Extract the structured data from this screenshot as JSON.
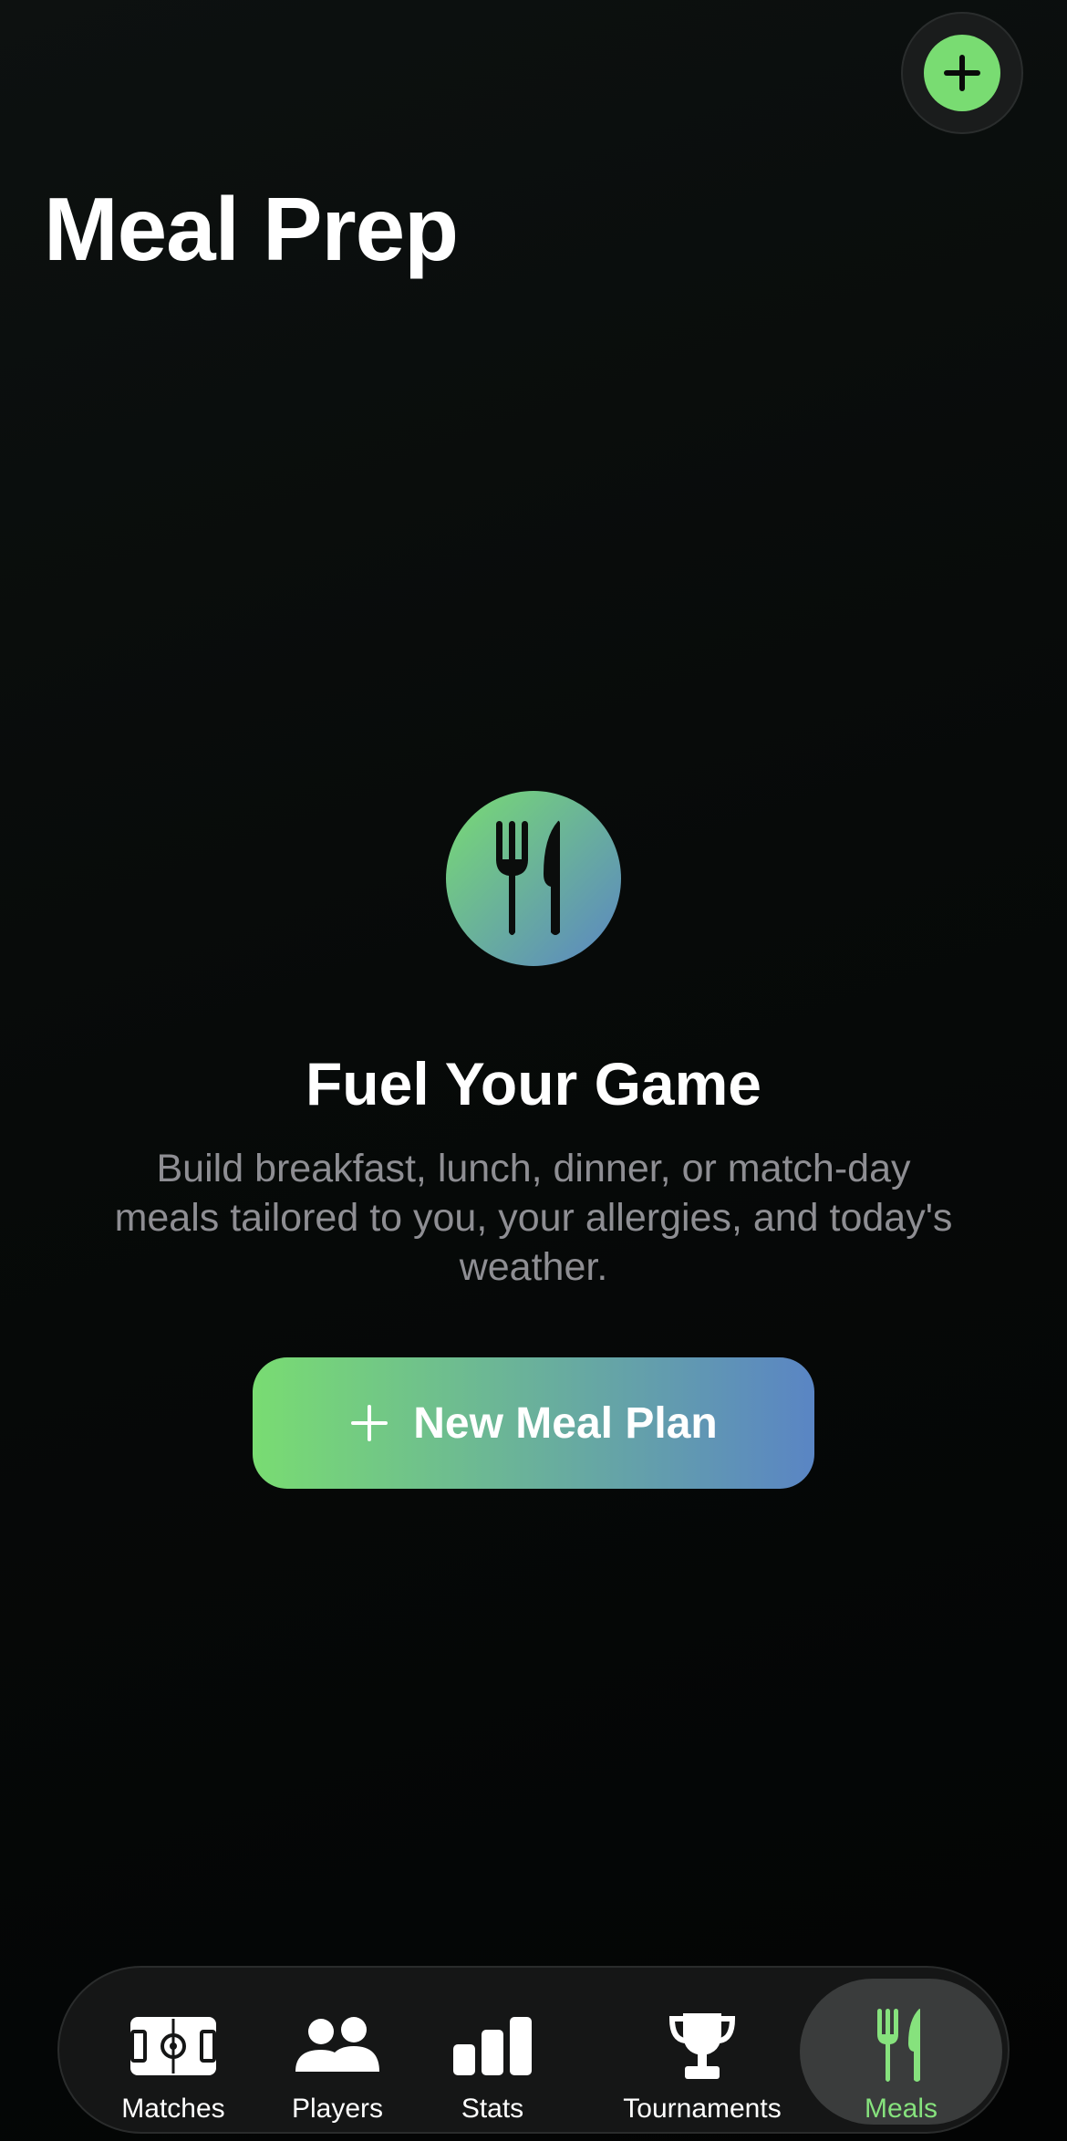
{
  "header": {
    "title": "Meal Prep",
    "add_button_icon": "plus-icon"
  },
  "empty_state": {
    "icon": "fork-knife-icon",
    "title": "Fuel Your Game",
    "description": "Build breakfast, lunch, dinner, or match-day meals tailored to you, your allergies, and today's weather.",
    "cta_label": "New Meal Plan",
    "cta_icon": "plus-icon"
  },
  "tabbar": {
    "items": [
      {
        "label": "Matches",
        "icon": "soccer-field-icon"
      },
      {
        "label": "Players",
        "icon": "people-icon"
      },
      {
        "label": "Stats",
        "icon": "bar-chart-icon"
      },
      {
        "label": "Tournaments",
        "icon": "trophy-icon"
      },
      {
        "label": "Meals",
        "icon": "fork-knife-icon",
        "selected": true
      }
    ]
  },
  "colors": {
    "accent_green": "#79dc72",
    "accent_blue": "#5a85c4",
    "text_primary": "#ffffff",
    "text_secondary": "#8e8e93",
    "tab_active": "#86e27d"
  }
}
